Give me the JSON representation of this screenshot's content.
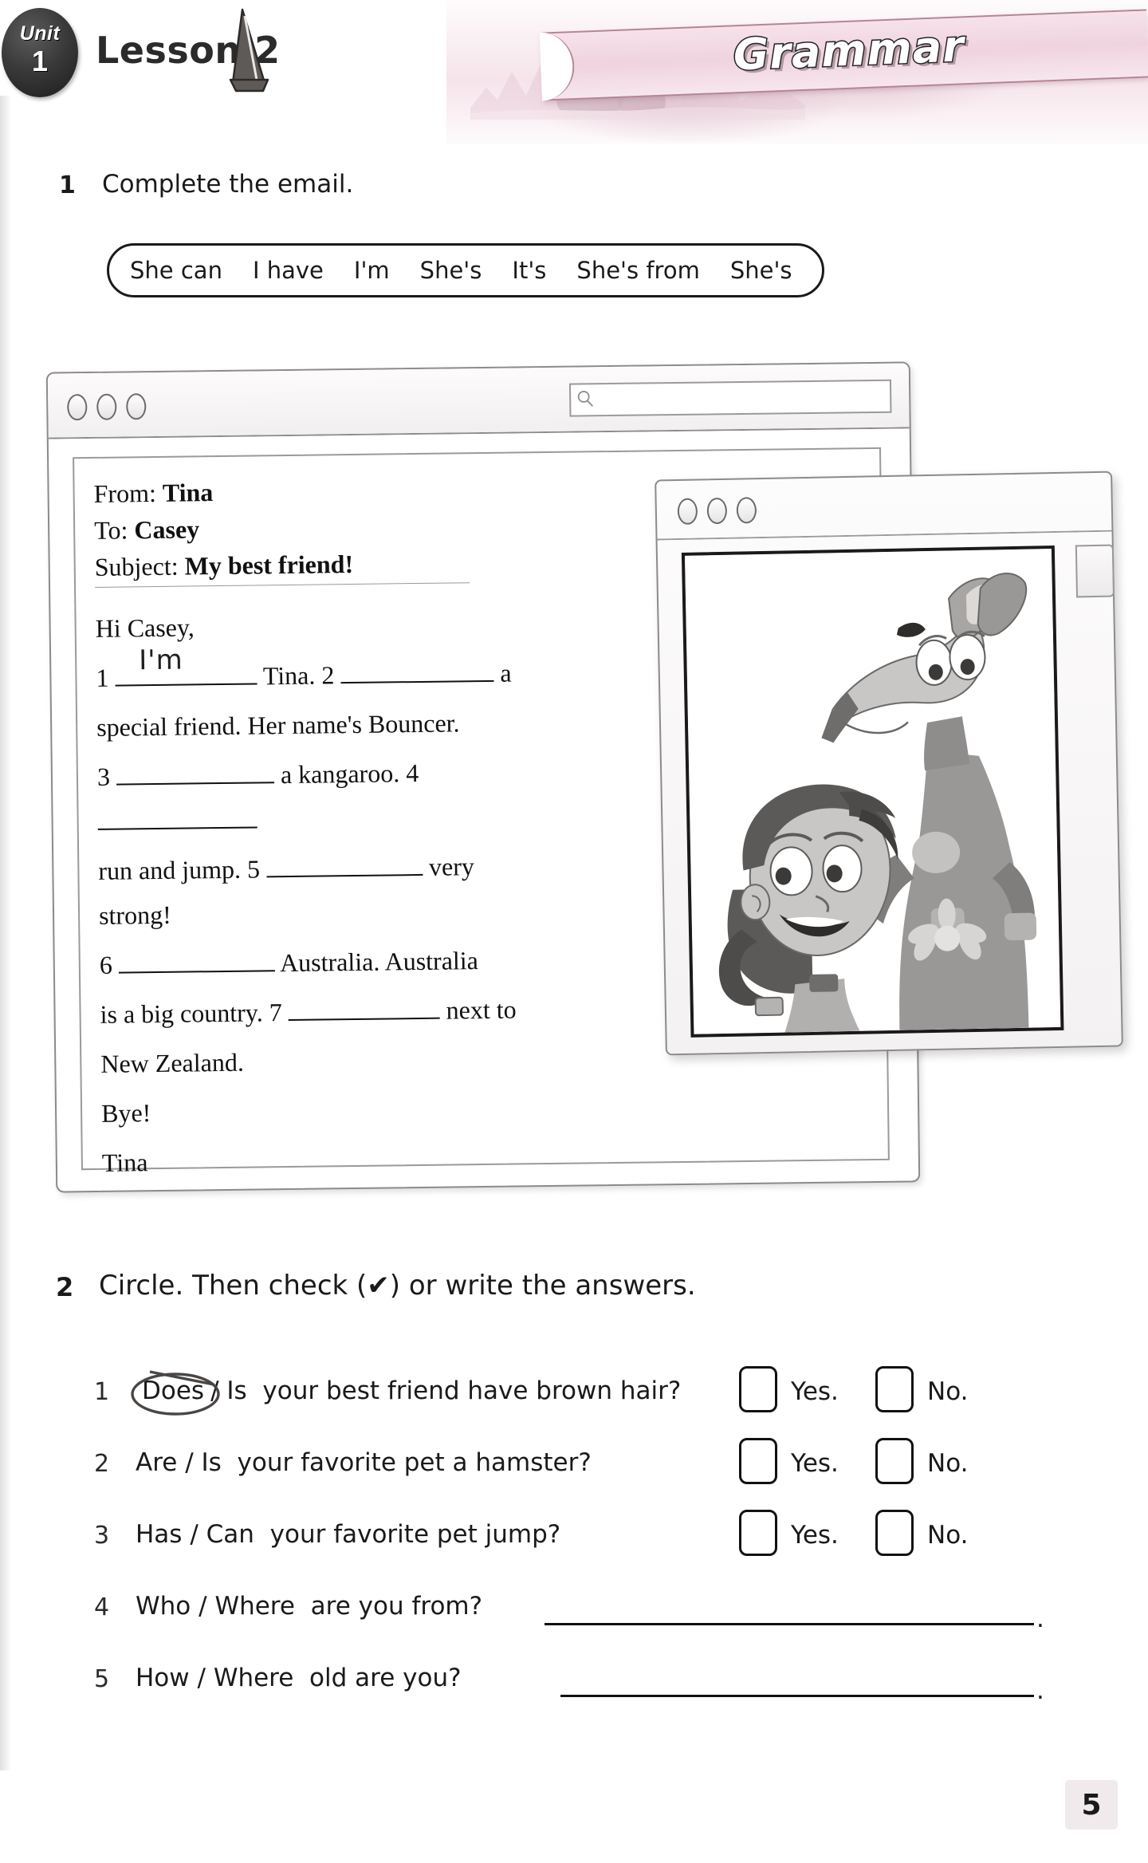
{
  "header": {
    "unit_word": "Unit",
    "unit_number": "1",
    "lesson_title": "Lesson 2",
    "banner_label": "Grammar",
    "sail_icon": "sailboat-icon"
  },
  "exercise1": {
    "number": "1",
    "instruction": "Complete the email.",
    "word_bank": [
      "She can",
      "I have",
      "I'm",
      "She's",
      "It's",
      "She's from",
      "She's"
    ],
    "email_window": {
      "dots": [
        "circle",
        "circle",
        "circle"
      ],
      "search_placeholder": "",
      "search_icon": "search-icon",
      "fields": [
        {
          "label": "From:",
          "value": "Tina"
        },
        {
          "label": "To:",
          "value": "Casey"
        },
        {
          "label": "Subject:",
          "value": "My best friend!"
        }
      ],
      "greeting": "Hi Casey,",
      "line1_a": "1",
      "blank1_answer": "I'm",
      "line1_b": "Tina. 2",
      "line1_c": "a",
      "line2": "special friend. Her name's Bouncer.",
      "line3_a": "3",
      "line3_b": "a kangaroo. 4",
      "line4_a": "run and jump. 5",
      "line4_b": "very strong!",
      "line5_a": "6",
      "line5_b": "Australia. Australia",
      "line6_a": "is a big country. 7",
      "line6_b": "next to",
      "line7": "New Zealand.",
      "closing": "Bye!",
      "signature": "Tina"
    },
    "image_window": {
      "dots": [
        "circle",
        "circle",
        "circle"
      ],
      "illustration": "girl-and-kangaroo-illustration"
    }
  },
  "exercise2": {
    "number": "2",
    "instruction": "Circle. Then check (✔) or write the answers.",
    "questions": [
      {
        "number": "1",
        "option_a": "Does",
        "option_b": "Is",
        "separator": "/",
        "rest": "your best friend have brown hair?",
        "circled_option": "Does",
        "answer_type": "checkbox",
        "yes_label": "Yes.",
        "no_label": "No."
      },
      {
        "number": "2",
        "option_a": "Are",
        "option_b": "Is",
        "separator": "/",
        "rest": "your favorite pet a hamster?",
        "circled_option": "",
        "answer_type": "checkbox",
        "yes_label": "Yes.",
        "no_label": "No."
      },
      {
        "number": "3",
        "option_a": "Has",
        "option_b": "Can",
        "separator": "/",
        "rest": "your favorite pet jump?",
        "circled_option": "",
        "answer_type": "checkbox",
        "yes_label": "Yes.",
        "no_label": "No."
      },
      {
        "number": "4",
        "option_a": "Who",
        "option_b": "Where",
        "separator": "/",
        "rest": "are you from?",
        "circled_option": "",
        "answer_type": "write-line",
        "line_value": "",
        "line_end": "."
      },
      {
        "number": "5",
        "option_a": "How",
        "option_b": "Where",
        "separator": "/",
        "rest": "old are you?",
        "circled_option": "",
        "answer_type": "write-line",
        "line_value": "",
        "line_end": "."
      }
    ]
  },
  "footer": {
    "page_number": "5"
  },
  "colors": {
    "banner_pink": "#efd3df",
    "banner_outline": "#b78497",
    "ink": "#1a1a1a",
    "window_border": "#8b8b8b"
  }
}
